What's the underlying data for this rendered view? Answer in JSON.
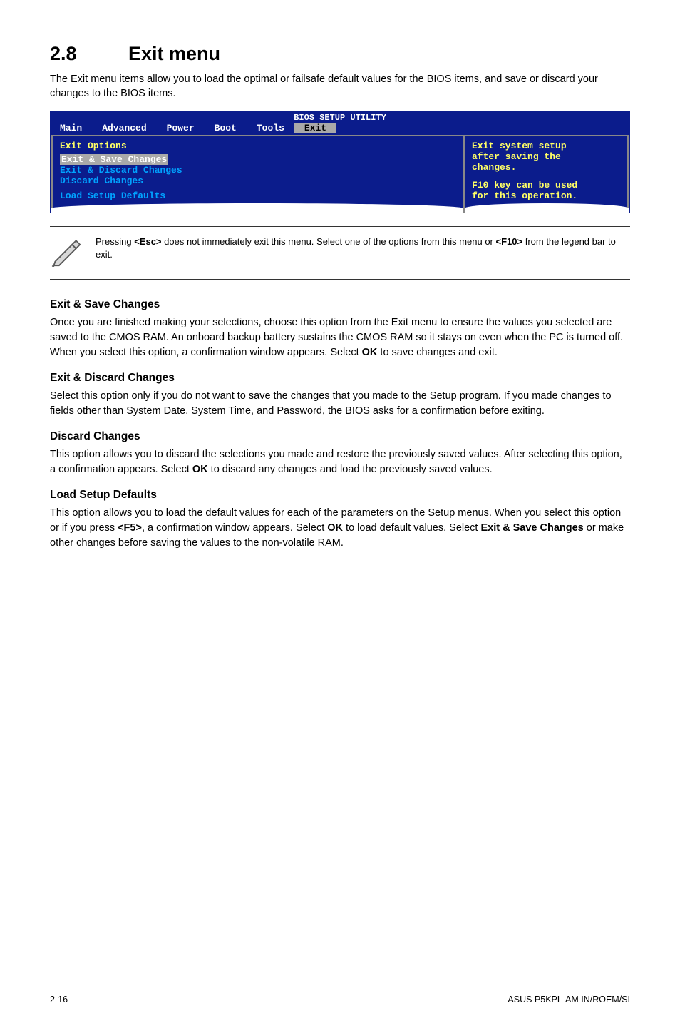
{
  "heading": {
    "num": "2.8",
    "title": "Exit menu"
  },
  "intro": "The Exit menu items allow you to load the optimal or failsafe default values for the BIOS items, and save or discard your changes to the BIOS items.",
  "bios": {
    "title": "BIOS SETUP UTILITY",
    "tabs": [
      "Main",
      "Advanced",
      "Power",
      "Boot",
      "Tools",
      "Exit"
    ],
    "active_tab": "Exit",
    "left": {
      "header": "Exit Options",
      "selected": "Exit & Save Changes",
      "items": [
        "Exit & Discard Changes",
        "Discard Changes"
      ],
      "after_gap": "Load Setup Defaults"
    },
    "help": {
      "l1": "Exit system setup",
      "l2": "after saving the",
      "l3": "changes.",
      "l4": "F10 key can be used",
      "l5": "for this operation."
    }
  },
  "note": {
    "pre": "Pressing ",
    "key1": "<Esc>",
    "mid": " does not immediately exit this menu. Select one of the options from this menu or ",
    "key2": "<F10>",
    "post": " from the legend bar to exit."
  },
  "sections": {
    "s1_h": "Exit & Save Changes",
    "s1_p_a": "Once you are finished making your selections, choose this option from the Exit menu to ensure the values you selected are saved to the CMOS RAM. An onboard backup battery sustains the CMOS RAM so it stays on even when the PC is turned off. When you select this option, a confirmation window appears. Select ",
    "s1_p_b": "OK",
    "s1_p_c": " to save changes and exit.",
    "s2_h": "Exit & Discard Changes",
    "s2_p": "Select this option only if you do not want to save the changes that you made to the Setup program. If you made changes to fields other than System Date, System Time, and Password, the BIOS asks for a confirmation before exiting.",
    "s3_h": "Discard Changes",
    "s3_p_a": "This option allows you to discard the selections you made and restore the previously saved values. After selecting this option, a confirmation appears. Select ",
    "s3_p_b": "OK",
    "s3_p_c": " to discard any changes and load the previously saved values.",
    "s4_h": "Load Setup Defaults",
    "s4_p_a": "This option allows you to load the default values for each of the parameters on the Setup menus. When you select this option or if you press ",
    "s4_p_b": "<F5>",
    "s4_p_c": ", a confirmation window appears. Select ",
    "s4_p_d": "OK",
    "s4_p_e": " to load default values. Select ",
    "s4_p_f": "Exit & Save Changes",
    "s4_p_g": " or make other changes before saving the values to the non-volatile RAM."
  },
  "footer": {
    "left": "2-16",
    "right": "ASUS P5KPL-AM IN/ROEM/SI"
  }
}
